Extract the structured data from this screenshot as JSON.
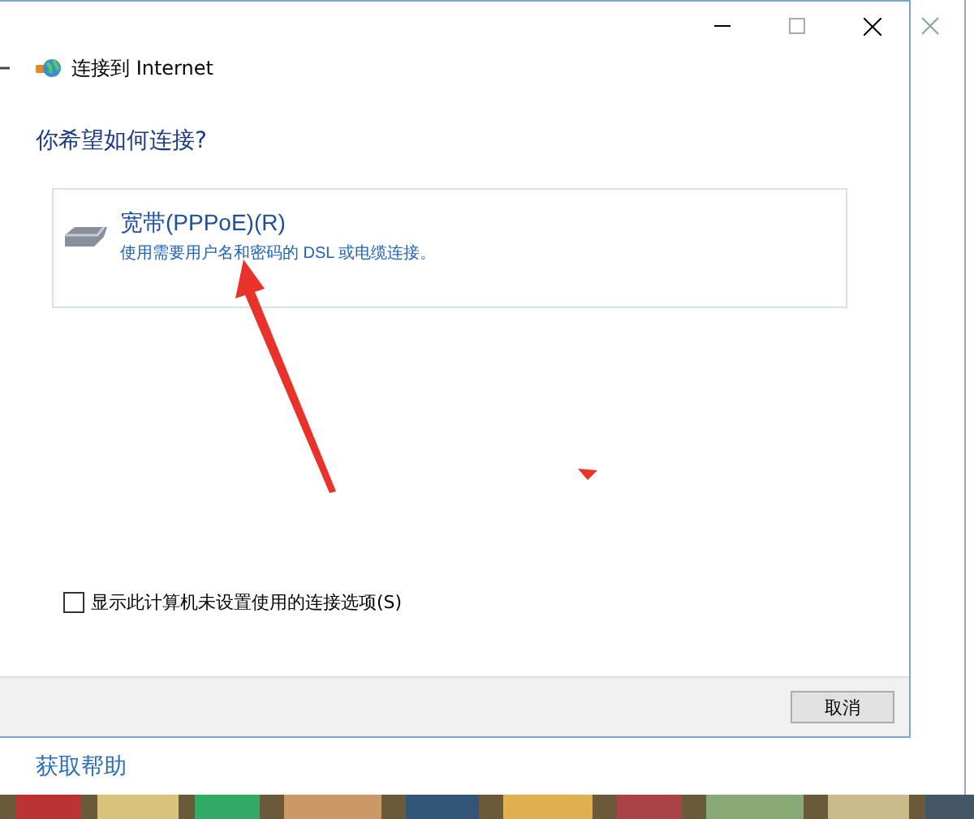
{
  "background_window": {
    "help_link": "获取帮助"
  },
  "dialog": {
    "title": "连接到 Internet",
    "heading": "你希望如何连接?",
    "options": [
      {
        "title": "宽带(PPPoE)(R)",
        "description": "使用需要用户名和密码的 DSL 或电缆连接。",
        "selected": false
      }
    ],
    "checkbox": {
      "label": "显示此计算机未设置使用的连接选项(S)",
      "checked": false
    },
    "buttons": [
      "取消"
    ]
  }
}
